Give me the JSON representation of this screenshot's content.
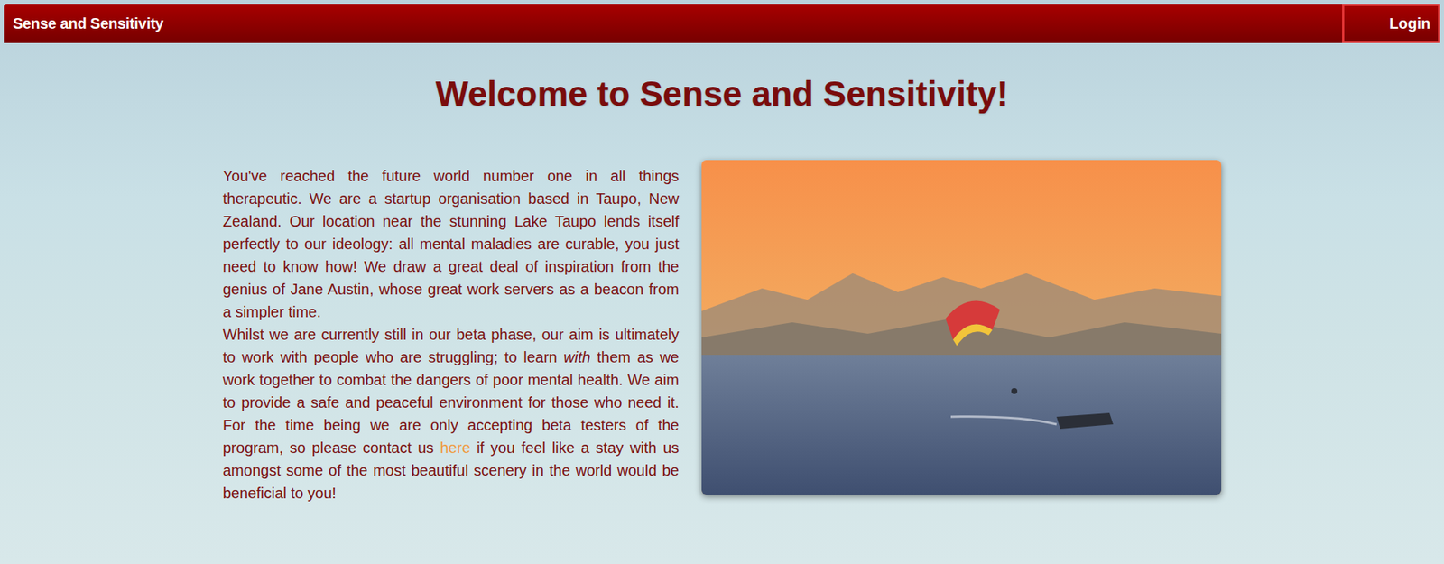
{
  "navbar": {
    "brand": "Sense and Sensitivity",
    "login": "Login"
  },
  "heading": "Welcome to Sense and Sensitivity!",
  "paragraphs": [
    [
      {
        "text": "You've reached the future world number one in all things therapeutic. We are a startup organisation based in Taupo, New Zealand. Our location near the stunning Lake Taupo lends itself perfectly to our ideology: all mental maladies are curable, you just need to know how! We draw a great deal of inspiration from the genius of Jane Austin, whose great work servers as a beacon from a simpler time.",
        "kind": "plain"
      }
    ],
    [
      {
        "text": "Whilst we are currently still in our beta phase, our aim is ultimately to work with people who are struggling; to learn ",
        "kind": "plain"
      },
      {
        "text": "with",
        "kind": "italic"
      },
      {
        "text": " them as we work together to combat the dangers of poor mental health. We aim to provide a safe and peaceful environment for those who need it. For the time being we are only accepting beta testers of the program, so please contact us ",
        "kind": "plain"
      },
      {
        "text": "here",
        "kind": "link"
      },
      {
        "text": " if you feel like a stay with us amongst some of the most beautiful scenery in the world would be beneficial to you!",
        "kind": "plain"
      }
    ]
  ]
}
